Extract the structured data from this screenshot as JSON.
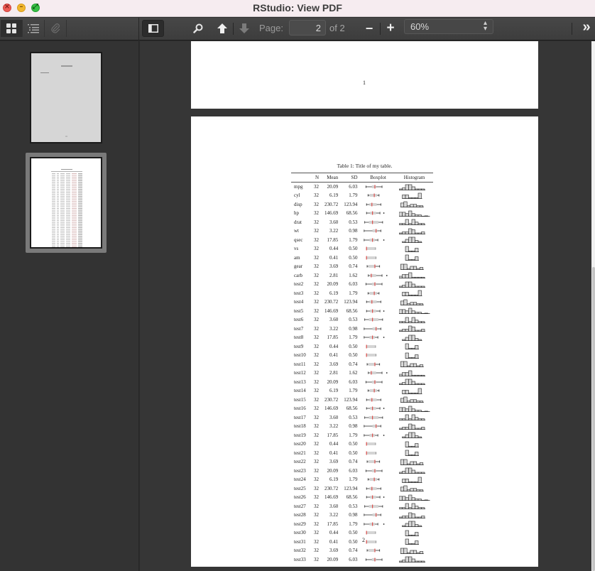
{
  "window": {
    "title": "RStudio: View PDF",
    "buttons": [
      "close",
      "minimize",
      "zoom"
    ]
  },
  "toolbar": {
    "sidebar_modes": [
      {
        "name": "thumbnails",
        "icon": "grid-icon",
        "active": true
      },
      {
        "name": "outline",
        "icon": "list-icon",
        "active": false
      },
      {
        "name": "attachments",
        "icon": "paperclip-icon",
        "active": false
      }
    ],
    "page_label": "Page:",
    "page_value": "2",
    "page_of": "of 2",
    "zoom_minus": "−",
    "zoom_plus": "+",
    "zoom_value": "60%",
    "more": "»"
  },
  "sidebar": {
    "thumbnails": [
      {
        "page": 1,
        "selected": false
      },
      {
        "page": 2,
        "selected": true
      }
    ]
  },
  "document": {
    "page1_number": "1",
    "page2_number": "2",
    "caption": "Table 1: Title of my table.",
    "columns": [
      "",
      "N",
      "Mean",
      "SD",
      "Boxplot",
      "Histogram"
    ],
    "accent_color": "#e0504d",
    "rows": [
      {
        "name": "mpg",
        "n": "32",
        "mean": "20.09",
        "sd": "6.03",
        "kind": "mpg"
      },
      {
        "name": "cyl",
        "n": "32",
        "mean": "6.19",
        "sd": "1.79",
        "kind": "cyl"
      },
      {
        "name": "disp",
        "n": "32",
        "mean": "230.72",
        "sd": "123.94",
        "kind": "disp"
      },
      {
        "name": "hp",
        "n": "32",
        "mean": "146.69",
        "sd": "68.56",
        "kind": "hp"
      },
      {
        "name": "drat",
        "n": "32",
        "mean": "3.60",
        "sd": "0.53",
        "kind": "drat"
      },
      {
        "name": "wt",
        "n": "32",
        "mean": "3.22",
        "sd": "0.98",
        "kind": "wt"
      },
      {
        "name": "qsec",
        "n": "32",
        "mean": "17.85",
        "sd": "1.79",
        "kind": "qsec"
      },
      {
        "name": "vs",
        "n": "32",
        "mean": "0.44",
        "sd": "0.50",
        "kind": "vs"
      },
      {
        "name": "am",
        "n": "32",
        "mean": "0.41",
        "sd": "0.50",
        "kind": "am"
      },
      {
        "name": "gear",
        "n": "32",
        "mean": "3.69",
        "sd": "0.74",
        "kind": "gear"
      },
      {
        "name": "carb",
        "n": "32",
        "mean": "2.81",
        "sd": "1.62",
        "kind": "carb"
      },
      {
        "name": "test2",
        "n": "32",
        "mean": "20.09",
        "sd": "6.03",
        "kind": "mpg"
      },
      {
        "name": "test3",
        "n": "32",
        "mean": "6.19",
        "sd": "1.79",
        "kind": "cyl"
      },
      {
        "name": "test4",
        "n": "32",
        "mean": "230.72",
        "sd": "123.94",
        "kind": "disp"
      },
      {
        "name": "test5",
        "n": "32",
        "mean": "146.69",
        "sd": "68.56",
        "kind": "hp"
      },
      {
        "name": "test6",
        "n": "32",
        "mean": "3.60",
        "sd": "0.53",
        "kind": "drat"
      },
      {
        "name": "test7",
        "n": "32",
        "mean": "3.22",
        "sd": "0.98",
        "kind": "wt"
      },
      {
        "name": "test8",
        "n": "32",
        "mean": "17.85",
        "sd": "1.79",
        "kind": "qsec"
      },
      {
        "name": "test9",
        "n": "32",
        "mean": "0.44",
        "sd": "0.50",
        "kind": "vs"
      },
      {
        "name": "test10",
        "n": "32",
        "mean": "0.41",
        "sd": "0.50",
        "kind": "am"
      },
      {
        "name": "test11",
        "n": "32",
        "mean": "3.69",
        "sd": "0.74",
        "kind": "gear"
      },
      {
        "name": "test12",
        "n": "32",
        "mean": "2.81",
        "sd": "1.62",
        "kind": "carb"
      },
      {
        "name": "test13",
        "n": "32",
        "mean": "20.09",
        "sd": "6.03",
        "kind": "mpg"
      },
      {
        "name": "test14",
        "n": "32",
        "mean": "6.19",
        "sd": "1.79",
        "kind": "cyl"
      },
      {
        "name": "test15",
        "n": "32",
        "mean": "230.72",
        "sd": "123.94",
        "kind": "disp"
      },
      {
        "name": "test16",
        "n": "32",
        "mean": "146.69",
        "sd": "68.56",
        "kind": "hp"
      },
      {
        "name": "test17",
        "n": "32",
        "mean": "3.60",
        "sd": "0.53",
        "kind": "drat"
      },
      {
        "name": "test18",
        "n": "32",
        "mean": "3.22",
        "sd": "0.98",
        "kind": "wt"
      },
      {
        "name": "test19",
        "n": "32",
        "mean": "17.85",
        "sd": "1.79",
        "kind": "qsec"
      },
      {
        "name": "test20",
        "n": "32",
        "mean": "0.44",
        "sd": "0.50",
        "kind": "vs"
      },
      {
        "name": "test21",
        "n": "32",
        "mean": "0.41",
        "sd": "0.50",
        "kind": "am"
      },
      {
        "name": "test22",
        "n": "32",
        "mean": "3.69",
        "sd": "0.74",
        "kind": "gear"
      },
      {
        "name": "test23",
        "n": "32",
        "mean": "20.09",
        "sd": "6.03",
        "kind": "mpg"
      },
      {
        "name": "test24",
        "n": "32",
        "mean": "6.19",
        "sd": "1.79",
        "kind": "cyl"
      },
      {
        "name": "test25",
        "n": "32",
        "mean": "230.72",
        "sd": "123.94",
        "kind": "disp"
      },
      {
        "name": "test26",
        "n": "32",
        "mean": "146.69",
        "sd": "68.56",
        "kind": "hp"
      },
      {
        "name": "test27",
        "n": "32",
        "mean": "3.60",
        "sd": "0.53",
        "kind": "drat"
      },
      {
        "name": "test28",
        "n": "32",
        "mean": "3.22",
        "sd": "0.98",
        "kind": "wt"
      },
      {
        "name": "test29",
        "n": "32",
        "mean": "17.85",
        "sd": "1.79",
        "kind": "qsec"
      },
      {
        "name": "test30",
        "n": "32",
        "mean": "0.44",
        "sd": "0.50",
        "kind": "vs"
      },
      {
        "name": "test31",
        "n": "32",
        "mean": "0.41",
        "sd": "0.50",
        "kind": "am"
      },
      {
        "name": "test32",
        "n": "32",
        "mean": "3.69",
        "sd": "0.74",
        "kind": "gear"
      },
      {
        "name": "test33",
        "n": "32",
        "mean": "20.09",
        "sd": "6.03",
        "kind": "mpg"
      }
    ],
    "sparkline_shapes": {
      "mpg": {
        "box": [
          0.08,
          0.62,
          0.28,
          0.42,
          0.38
        ],
        "outlier": null,
        "hist": [
          1,
          2,
          5,
          5,
          3,
          1,
          1,
          1
        ]
      },
      "cyl": {
        "box": [
          0.15,
          0.52,
          0.2,
          0.45,
          0.36
        ],
        "outlier": null,
        "hist": [
          4,
          4,
          1,
          1,
          1,
          6
        ]
      },
      "disp": {
        "box": [
          0.1,
          0.58,
          0.2,
          0.44,
          0.28
        ],
        "outlier": null,
        "hist": [
          3,
          4,
          1,
          2,
          2,
          1,
          1
        ]
      },
      "hp": {
        "box": [
          0.1,
          0.55,
          0.22,
          0.42,
          0.3
        ],
        "outlier": 0.68,
        "hist": [
          3,
          3,
          2,
          4,
          2,
          1,
          1,
          0,
          0.3
        ]
      },
      "drat": {
        "box": [
          0.04,
          0.64,
          0.18,
          0.5,
          0.3
        ],
        "outlier": null,
        "hist": [
          1,
          1,
          4,
          1,
          4,
          2,
          1,
          1
        ]
      },
      "wt": {
        "box": [
          0.02,
          0.58,
          0.3,
          0.46,
          0.42
        ],
        "outlier": null,
        "hist": [
          1,
          2,
          2,
          5,
          4,
          1,
          1,
          2
        ]
      },
      "qsec": {
        "box": [
          0.02,
          0.48,
          0.2,
          0.38,
          0.3
        ],
        "outlier": 0.68,
        "hist": [
          1,
          3,
          5,
          5,
          2,
          1
        ]
      },
      "vs": {
        "box": [
          0.1,
          0.4,
          0.1,
          0.4,
          0.1
        ],
        "outlier": null,
        "hist": [
          6,
          1,
          1,
          4
        ]
      },
      "am": {
        "box": [
          0.1,
          0.42,
          0.1,
          0.42,
          0.1
        ],
        "outlier": null,
        "hist": [
          6,
          1,
          1,
          4
        ]
      },
      "gear": {
        "box": [
          0.12,
          0.54,
          0.16,
          0.4,
          0.38
        ],
        "outlier": null,
        "hist": [
          5,
          5,
          1,
          3,
          3,
          1,
          2
        ]
      },
      "carb": {
        "box": [
          0.16,
          0.62,
          0.22,
          0.42,
          0.26
        ],
        "outlier": 0.78,
        "hist": [
          2,
          4,
          4,
          6,
          1,
          1,
          1,
          1
        ]
      }
    }
  }
}
